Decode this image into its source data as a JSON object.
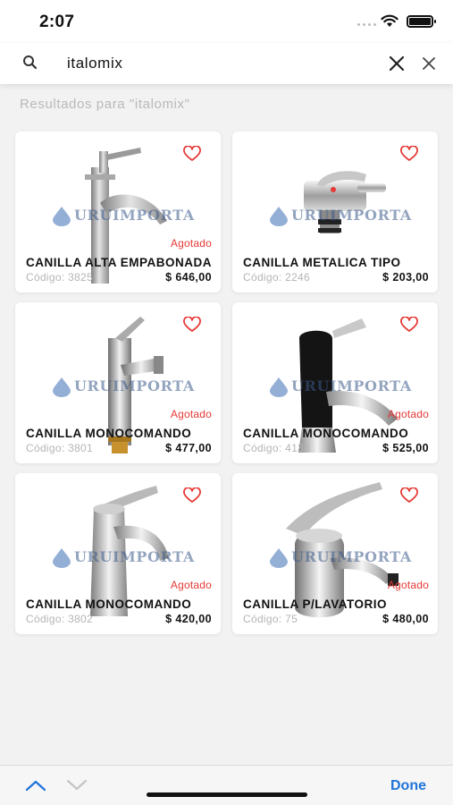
{
  "status": {
    "time": "2:07"
  },
  "search": {
    "value": "italomix",
    "placeholder": ""
  },
  "results_title": "Resultados para \"italomix\"",
  "brand_watermark": "URUIMPORTA",
  "colors": {
    "accent": "#1f73d9",
    "sold_out": "#e53935",
    "heart": "#e53935"
  },
  "products": [
    {
      "name": "CANILLA ALTA EMPABONADA",
      "code": "Código: 3825",
      "price": "$ 646,00",
      "status": "Agotado",
      "image": "tall-lever-faucet"
    },
    {
      "name": "CANILLA METALICA TIPO",
      "code": "Código: 2246",
      "price": "$ 203,00",
      "status": "",
      "image": "wall-lever-tap"
    },
    {
      "name": "CANILLA MONOCOMANDO",
      "code": "Código: 3801",
      "price": "$ 477,00",
      "status": "Agotado",
      "image": "chrome-mixer-faucet"
    },
    {
      "name": "CANILLA MONOCOMANDO",
      "code": "Código: 4133",
      "price": "$ 525,00",
      "status": "Agotado",
      "image": "black-chrome-faucet"
    },
    {
      "name": "CANILLA MONOCOMANDO",
      "code": "Código: 3802",
      "price": "$ 420,00",
      "status": "Agotado",
      "image": "basin-mixer-faucet"
    },
    {
      "name": "CANILLA P/LAVATORIO",
      "code": "Código: 75",
      "price": "$ 480,00",
      "status": "Agotado",
      "image": "lavatory-faucet"
    }
  ],
  "toolbar": {
    "done_label": "Done"
  }
}
